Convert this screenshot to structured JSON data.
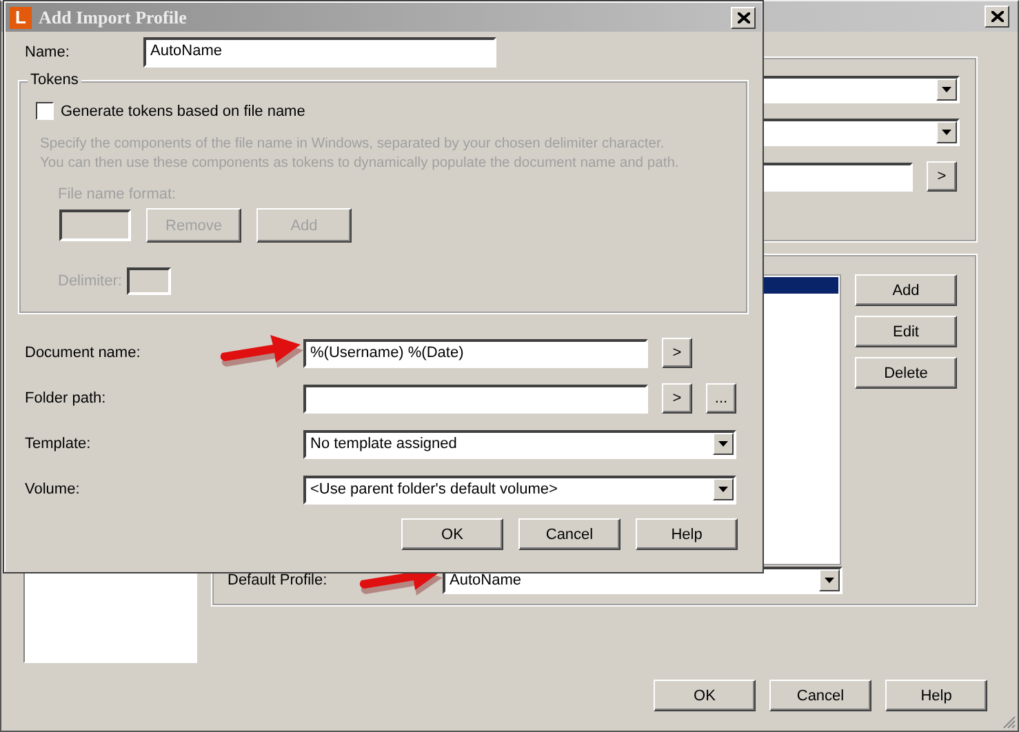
{
  "main_window": {
    "profile_list": {
      "rows": [
        {
          "selected": true
        }
      ]
    },
    "profile_buttons": [
      "Add",
      "Edit",
      "Delete"
    ],
    "group_buttons": [
      ">"
    ],
    "default_profile": {
      "label": "Default Profile:",
      "value": "AutoName",
      "arrow": true
    },
    "buttons": [
      "OK",
      "Cancel",
      "Help"
    ]
  },
  "dialog": {
    "title": "Add Import Profile",
    "icon_letter": "L",
    "name": {
      "label": "Name:",
      "value": "AutoName"
    },
    "tokens": {
      "title": "Tokens",
      "disabled": true,
      "generate": {
        "label": "Generate tokens based on file name",
        "checked": false
      },
      "description_lines": [
        "Specify the components of the file name in Windows, separated by your chosen delimiter character.",
        "You can then use these components as tokens to dynamically populate the document name and path."
      ],
      "format_label": "File name format:",
      "remove": "Remove",
      "add": "Add",
      "delimiter_label": "Delimiter:"
    },
    "fields": [
      {
        "kind": "text",
        "label": "Document name:",
        "value": "%(Username) %(Date)",
        "buttons": [
          ">"
        ],
        "arrow": true
      },
      {
        "kind": "text",
        "label": "Folder path:",
        "buttons": [
          ">",
          "..."
        ],
        "arrow": false
      },
      {
        "kind": "combo",
        "label": "Template:",
        "value": "No template assigned",
        "arrow": false
      },
      {
        "kind": "combo",
        "label": "Volume:",
        "value": "<Use parent folder's default volume>",
        "arrow": false
      }
    ],
    "buttons": [
      "OK",
      "Cancel",
      "Help"
    ]
  }
}
